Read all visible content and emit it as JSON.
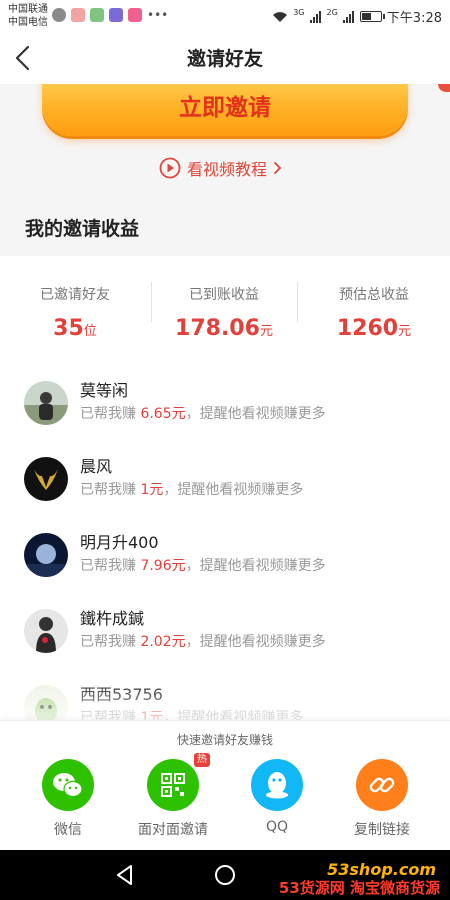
{
  "status_bar": {
    "carrier_1": "中国联通",
    "carrier_2": "中国电信",
    "network_1": "3G",
    "network_2": "2G",
    "time": "下午3:28",
    "battery_level": 0.55
  },
  "header": {
    "title": "邀请好友"
  },
  "invite": {
    "button_label": "立即邀请",
    "video_label": "看视频教程"
  },
  "earnings": {
    "section_title": "我的邀请收益",
    "stats": [
      {
        "label": "已邀请好友",
        "value": "35",
        "unit": "位"
      },
      {
        "label": "已到账收益",
        "value": "178.06",
        "unit": "元"
      },
      {
        "label": "预估总收益",
        "value": "1260",
        "unit": "元"
      }
    ]
  },
  "friends": [
    {
      "name": "莫等闲",
      "prefix": "已帮我赚 ",
      "amount": "6.65元",
      "suffix": "，提醒他看视频赚更多"
    },
    {
      "name": "晨风",
      "prefix": "已帮我赚 ",
      "amount": "1元",
      "suffix": "，提醒他看视频赚更多"
    },
    {
      "name": "明月升400",
      "prefix": "已帮我赚 ",
      "amount": "7.96元",
      "suffix": "，提醒他看视频赚更多"
    },
    {
      "name": "鐵杵成鍼",
      "prefix": "已帮我赚 ",
      "amount": "2.02元",
      "suffix": "，提醒他看视频赚更多"
    },
    {
      "name": "西西53756",
      "prefix": "已帮我赚 ",
      "amount": "1元",
      "suffix": "，提醒他看视频赚更多"
    }
  ],
  "share": {
    "title": "快速邀请好友赚钱",
    "options": [
      {
        "label": "微信",
        "icon": "wechat-icon",
        "color": "#2dc100"
      },
      {
        "label": "面对面邀请",
        "icon": "qrcode-icon",
        "color": "#2dc100",
        "badge": "热"
      },
      {
        "label": "QQ",
        "icon": "qq-icon",
        "color": "#12b7f5"
      },
      {
        "label": "复制链接",
        "icon": "link-icon",
        "color": "#ff7f1a"
      }
    ]
  },
  "colors": {
    "accent_red": "#e2403a",
    "button_orange": "#ffb228",
    "wechat_green": "#2dc100",
    "qq_blue": "#12b7f5",
    "link_orange": "#ff7f1a"
  },
  "watermark": {
    "url": "53shop.com",
    "text": "53货源网 淘宝微商货源"
  }
}
